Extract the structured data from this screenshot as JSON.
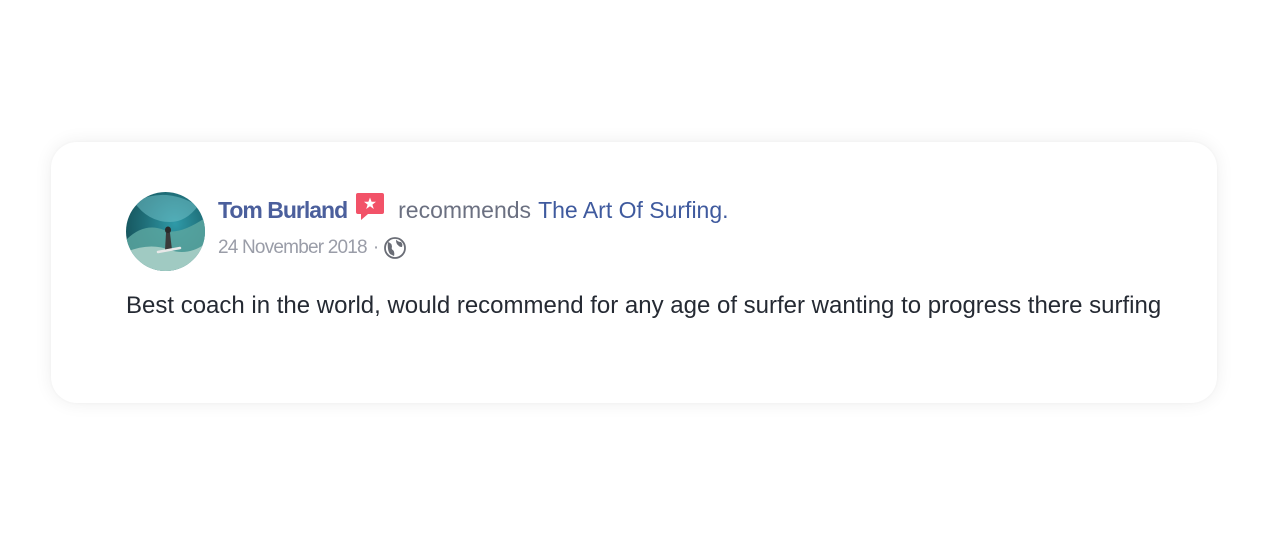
{
  "review": {
    "author": "Tom Burland",
    "action_text": "recommends",
    "page_name": "The Art Of Surfing.",
    "date": "24 November 2018",
    "separator": "·",
    "body": "Best coach in the world, would recommend for any age of surfer wanting to progress there surfing"
  },
  "icons": {
    "recommend": "recommendation-icon",
    "privacy": "globe-icon",
    "avatar": "surfer-profile-photo"
  },
  "colors": {
    "link": "#3f5a9e",
    "name": "#4b5f9c",
    "recommend_badge": "#f25268",
    "meta": "#9a9da8",
    "body_text": "#252a33"
  }
}
